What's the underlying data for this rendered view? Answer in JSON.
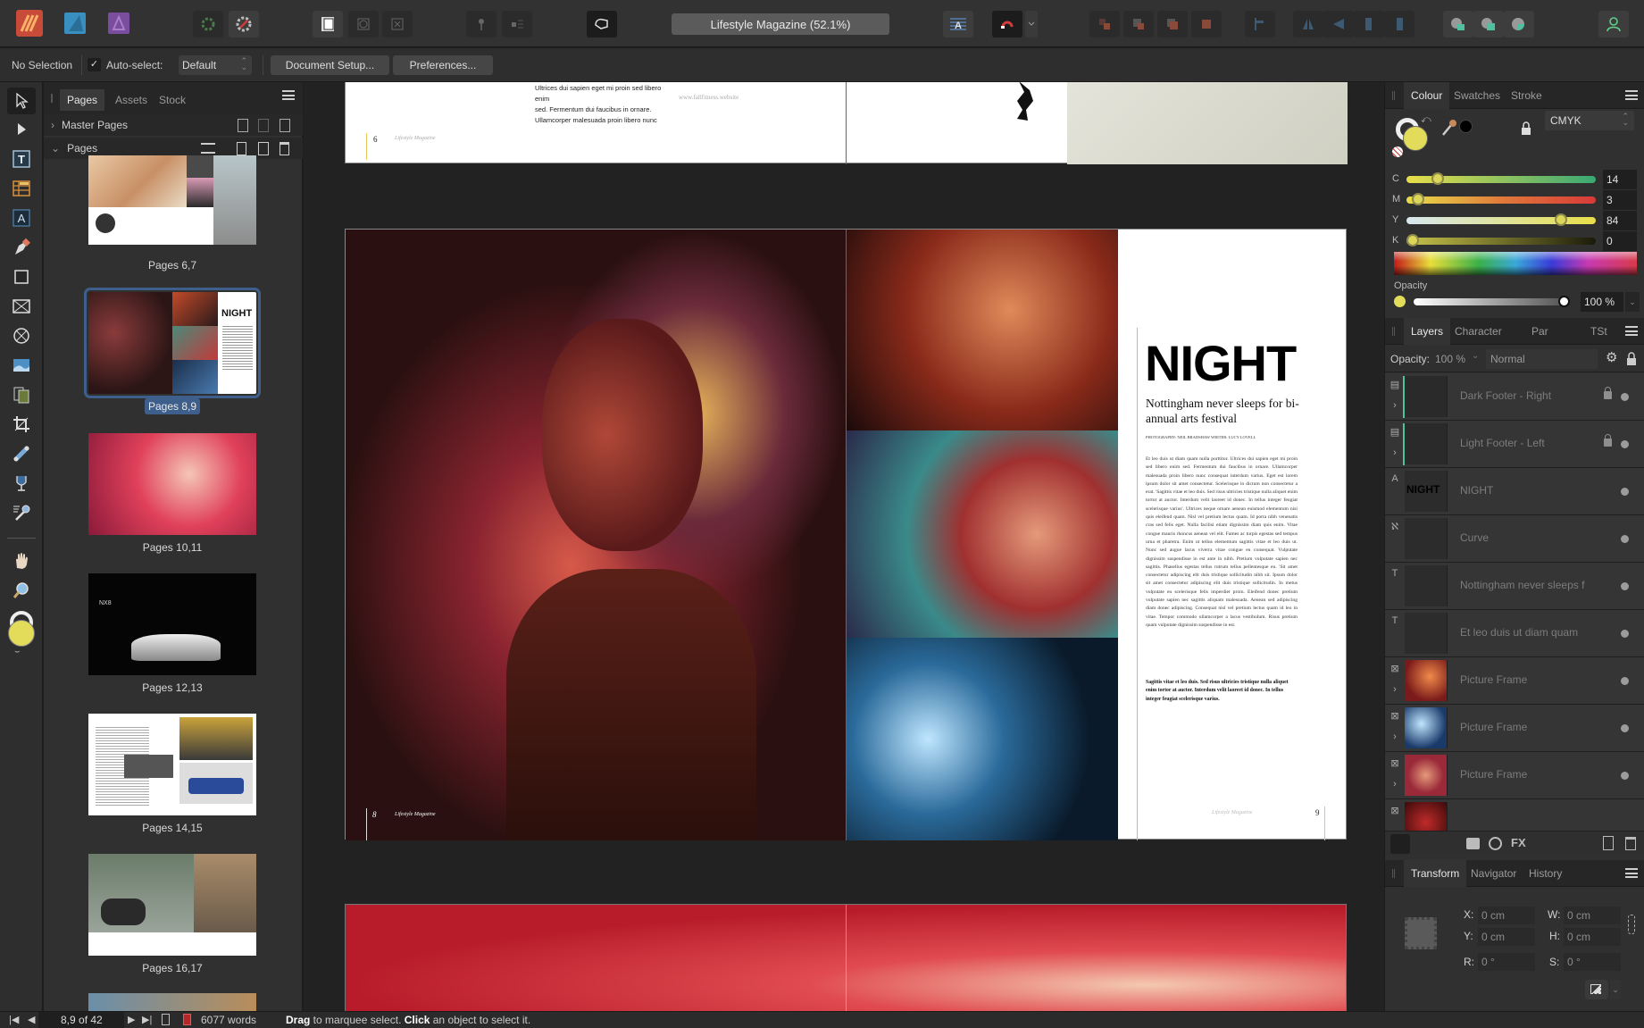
{
  "app": {
    "document_title": "Lifestyle Magazine (52.1%)",
    "personas": [
      "publisher-persona-icon",
      "designer-persona-icon",
      "photo-persona-icon"
    ]
  },
  "context_bar": {
    "selection": "No Selection",
    "auto_select_label": "Auto-select:",
    "auto_select_checked": true,
    "auto_select_value": "Default",
    "document_setup": "Document Setup...",
    "preferences": "Preferences..."
  },
  "pages_panel": {
    "tabs": [
      "Pages",
      "Assets",
      "Stock"
    ],
    "active_tab": "Pages",
    "master_pages_label": "Master Pages",
    "pages_label": "Pages",
    "thumbnails": [
      {
        "label": "Pages 6,7",
        "selected": false
      },
      {
        "label": "Pages 8,9",
        "selected": true
      },
      {
        "label": "Pages 10,11",
        "selected": false
      },
      {
        "label": "Pages 12,13",
        "selected": false
      },
      {
        "label": "Pages 14,15",
        "selected": false
      },
      {
        "label": "Pages 16,17",
        "selected": false
      }
    ]
  },
  "canvas": {
    "top_spread": {
      "body_lines": [
        "Ultrices dui sapien eget mi proin sed libero enim",
        "sed. Fermentum dui faucibus in ornare.",
        "Ullamcorper malesuada proin libero nunc"
      ],
      "website": "www.fallfitness.website",
      "page_number": "6",
      "footer": "Lifestyle Magazine"
    },
    "main_spread": {
      "headline": "NIGHT",
      "subhead": "Nottingham never sleeps for bi-annual arts festival",
      "credits": "PHOTOGRAPHY: NEIL BRADSHAW  WRITER: LUCY LOVELL",
      "body": "Et leo duis ut diam quam nulla porttitor. Ultrices dui sapien eget mi proin sed libero enim sed. Fermentum dui faucibus in ornare. Ullamcorper malesuada proin libero nunc consequat interdum varius. Eget est lorem ipsum dolor sit amet consectetur. Scelerisque in dictum non consectetur a erat. 'Sagittis vitae et leo duis. Sed risus ultricies tristique nulla aliquet enim tortor at auctor. Interdum velit laoreet id donec. In tellus integer feugiat scelerisque varius'. Ultrices neque ornare aenean euismod elementum nisi quis eleifend quam. Nisl vel pretium lectus quam. Id porta nibh venenatis cras sed felis eget. Nulla facilisi etiam dignissim diam quis enim. Vitae congue mauris rhoncus aenean vel elit. Fames ac turpis egestas sed tempus urna et pharetra. Enim ut tellus elementum sagittis vitae et leo duis ut. Nunc sed augue lacus viverra vitae congue eu consequat. Vulputate dignissim suspendisse in est ante in nibh. Pretium vulputate sapien nec sagittis. Phasellus egestas tellus rutrum tellus pellentesque eu. 'Sit amet consectetur adipiscing elit duis tristique sollicitudin nibh sit. Ipsum dolor sit amet consectetur adipiscing elit duis tristique sollicitudin. In metus vulputate eu scelerisque felis imperdiet proin. Eleifend donec pretium vulputate sapien nec sagittis aliquam malesuada. Aenean sed adipiscing diam donec adipiscing. Consequat nisl vel pretium lectus quam id leo in vitae. Tempor commodo ullamcorper a lacus vestibulum. Risus pretium quam vulputate dignissim suspendisse in est.",
      "pull_quote": "Sagittis vitae et leo duis. Sed risus ultricies tristique nulla aliquet enim tortor at auctor. Interdum velit laoreet id donec. In tellus integer feugiat scelerisque varius.",
      "left_page_number": "8",
      "right_page_number": "9",
      "footer": "Lifestyle Magazine"
    }
  },
  "colour_panel": {
    "tabs": [
      "Colour",
      "Swatches",
      "Stroke"
    ],
    "active_tab": "Colour",
    "model": "CMYK",
    "fill_color": "#e3dc5a",
    "channels": [
      {
        "label": "C",
        "value": "14",
        "fraction": 0.14
      },
      {
        "label": "M",
        "value": "3",
        "fraction": 0.03
      },
      {
        "label": "Y",
        "value": "84",
        "fraction": 0.84
      },
      {
        "label": "K",
        "value": "0",
        "fraction": 0.0
      }
    ],
    "opacity_label": "Opacity",
    "opacity_value": "100 %"
  },
  "layers_panel": {
    "tabs": [
      "Layers",
      "Character",
      "Par",
      "TSt"
    ],
    "active_tab": "Layers",
    "opacity_label": "Opacity:",
    "opacity_value": "100 %",
    "blend_mode": "Normal",
    "layers": [
      {
        "name": "Dark Footer - Right",
        "kind": "master",
        "locked": true,
        "expandable": true
      },
      {
        "name": "Light Footer - Left",
        "kind": "master",
        "locked": true,
        "expandable": true
      },
      {
        "name": "NIGHT",
        "kind": "art-text",
        "locked": false,
        "expandable": false
      },
      {
        "name": "Curve",
        "kind": "curve",
        "locked": false,
        "expandable": false
      },
      {
        "name": "Nottingham never sleeps f",
        "kind": "frame-text",
        "locked": false,
        "expandable": false
      },
      {
        "name": "Et leo duis ut diam quam",
        "kind": "frame-text",
        "locked": false,
        "expandable": false
      },
      {
        "name": "Picture Frame",
        "kind": "picture-frame",
        "locked": false,
        "expandable": true
      },
      {
        "name": "Picture Frame",
        "kind": "picture-frame",
        "locked": false,
        "expandable": true
      },
      {
        "name": "Picture Frame",
        "kind": "picture-frame",
        "locked": false,
        "expandable": true
      }
    ]
  },
  "transform_panel": {
    "tabs": [
      "Transform",
      "Navigator",
      "History"
    ],
    "active_tab": "Transform",
    "fields": {
      "x": {
        "label": "X:",
        "value": "0 cm"
      },
      "y": {
        "label": "Y:",
        "value": "0 cm"
      },
      "w": {
        "label": "W:",
        "value": "0 cm"
      },
      "h": {
        "label": "H:",
        "value": "0 cm"
      },
      "r": {
        "label": "R:",
        "value": "0 °"
      },
      "s": {
        "label": "S:",
        "value": "0 °"
      }
    }
  },
  "status_bar": {
    "page_indicator": "8,9 of 42",
    "word_count": "6077 words",
    "hint_bold_1": "Drag",
    "hint_1": " to marquee select. ",
    "hint_bold_2": "Click",
    "hint_2": " an object to select it."
  }
}
